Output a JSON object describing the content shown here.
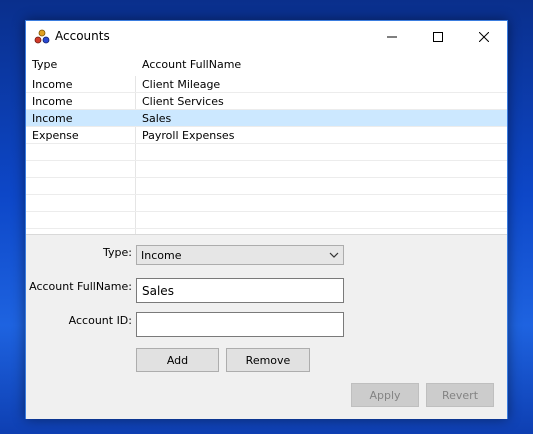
{
  "window": {
    "title": "Accounts"
  },
  "list": {
    "headers": {
      "type": "Type",
      "name": "Account FullName"
    },
    "rows": [
      {
        "type": "Income",
        "name": "Client Mileage",
        "selected": false
      },
      {
        "type": "Income",
        "name": "Client Services",
        "selected": false
      },
      {
        "type": "Income",
        "name": "Sales",
        "selected": true
      },
      {
        "type": "Expense",
        "name": "Payroll Expenses",
        "selected": false
      }
    ]
  },
  "form": {
    "type_label": "Type:",
    "type_value": "Income",
    "name_label": "Account FullName:",
    "name_value": "Sales",
    "id_label": "Account ID:",
    "id_value": "",
    "add_label": "Add",
    "remove_label": "Remove",
    "apply_label": "Apply",
    "revert_label": "Revert"
  },
  "colors": {
    "selection": "#cce8ff",
    "desktop": "#0d47c8"
  }
}
